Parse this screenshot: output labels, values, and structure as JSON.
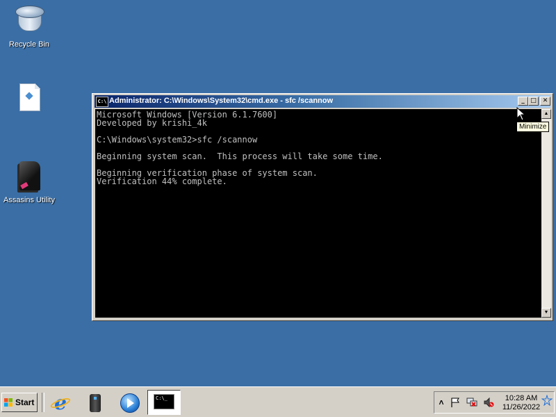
{
  "desktop": {
    "background": "#3a6ea5",
    "icons": [
      {
        "label": "Recycle Bin",
        "icon": "recycle-bin-icon"
      },
      {
        "label": "",
        "icon": "file-icon"
      },
      {
        "label": "Assasins Utility",
        "icon": "assassins-utility-icon"
      }
    ]
  },
  "window": {
    "title": "Administrator: C:\\Windows\\System32\\cmd.exe - sfc  /scannow",
    "icon_text": "C:\\",
    "buttons": {
      "minimize": "_",
      "maximize": "□",
      "close": "✕"
    },
    "tooltip": "Minimize",
    "console_lines": [
      "Microsoft Windows [Version 6.1.7600]",
      "Developed by krishi_4k",
      "",
      "C:\\Windows\\system32>sfc /scannow",
      "",
      "Beginning system scan.  This process will take some time.",
      "",
      "Beginning verification phase of system scan.",
      "Verification 44% complete."
    ],
    "colors": {
      "console_bg": "#000000",
      "console_text": "#c0c0c0",
      "title_start": "#0a246a",
      "title_end": "#a6caf0"
    }
  },
  "taskbar": {
    "start_label": "Start",
    "quick_launch": [
      "internet-explorer-icon",
      "usb-drive-icon",
      "media-player-icon"
    ],
    "active_task": {
      "icon": "command-prompt-icon",
      "glyph_text": "C:\\_"
    },
    "tray": {
      "icons": [
        "show-hidden-icons-chevron",
        "action-center-flag-icon",
        "network-icon",
        "volume-muted-icon"
      ],
      "time": "10:28 AM",
      "date": "11/26/2022"
    }
  }
}
